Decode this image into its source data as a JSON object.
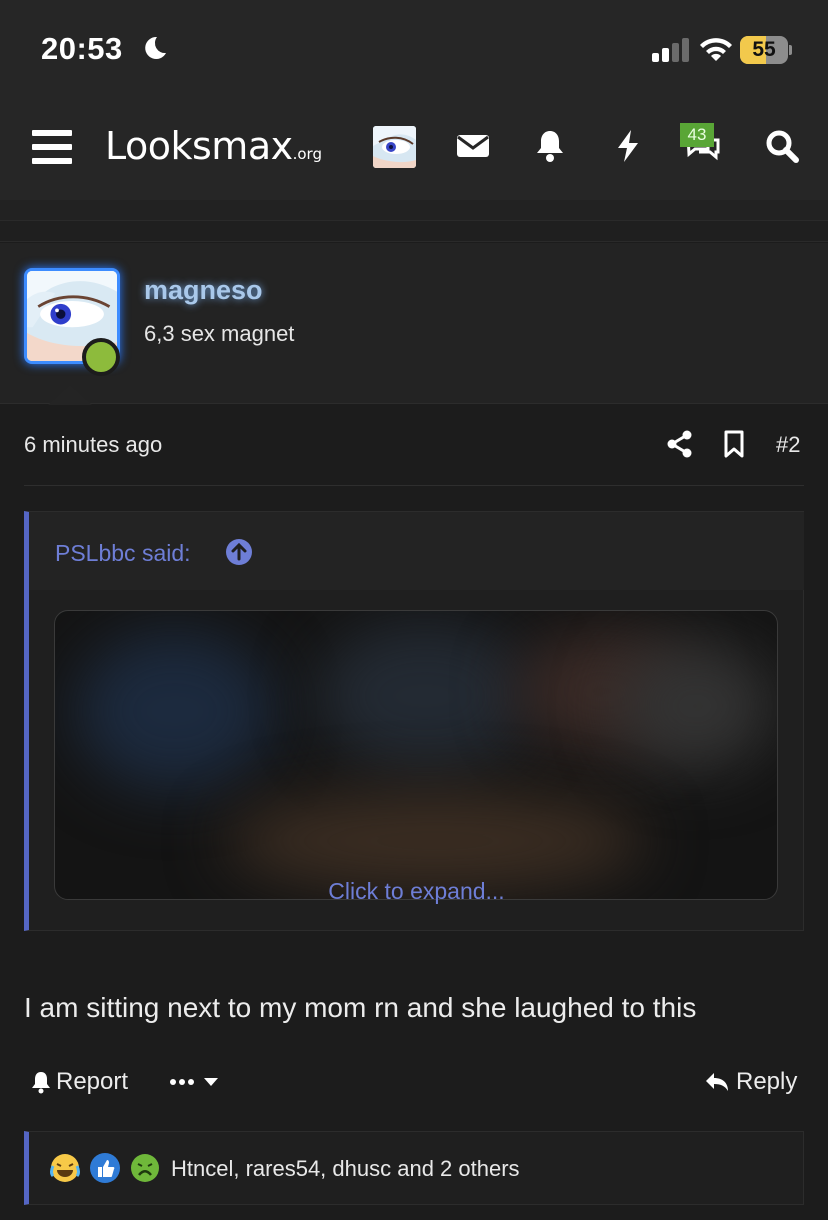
{
  "status_bar": {
    "time": "20:53",
    "battery": "55",
    "battery_level": 0.55
  },
  "nav": {
    "logo_main": "Looksmax",
    "logo_suffix": ".org",
    "conversation_badge": "43"
  },
  "post": {
    "username": "magneso",
    "user_title": "6,3 sex magnet",
    "time": "6 minutes ago",
    "post_number": "#2",
    "quote": {
      "author": "PSLbbc said:",
      "expand_label": "Click to expand..."
    },
    "body": "I am sitting next to my mom rn and she laughed to this",
    "actions": {
      "report": "Report",
      "reply": "Reply"
    },
    "reactions": {
      "icons": [
        "crying-laughing-icon",
        "like-icon",
        "sick-face-icon"
      ],
      "summary": "Htncel, rares54, dhusc and 2 others"
    }
  },
  "colors": {
    "background": "#1c1c1c",
    "header": "#262626",
    "accent": "#5566c4",
    "link": "#6e7ed6",
    "online": "#8dbb3c",
    "badge": "#59a636",
    "battery": "#f2c94c"
  }
}
